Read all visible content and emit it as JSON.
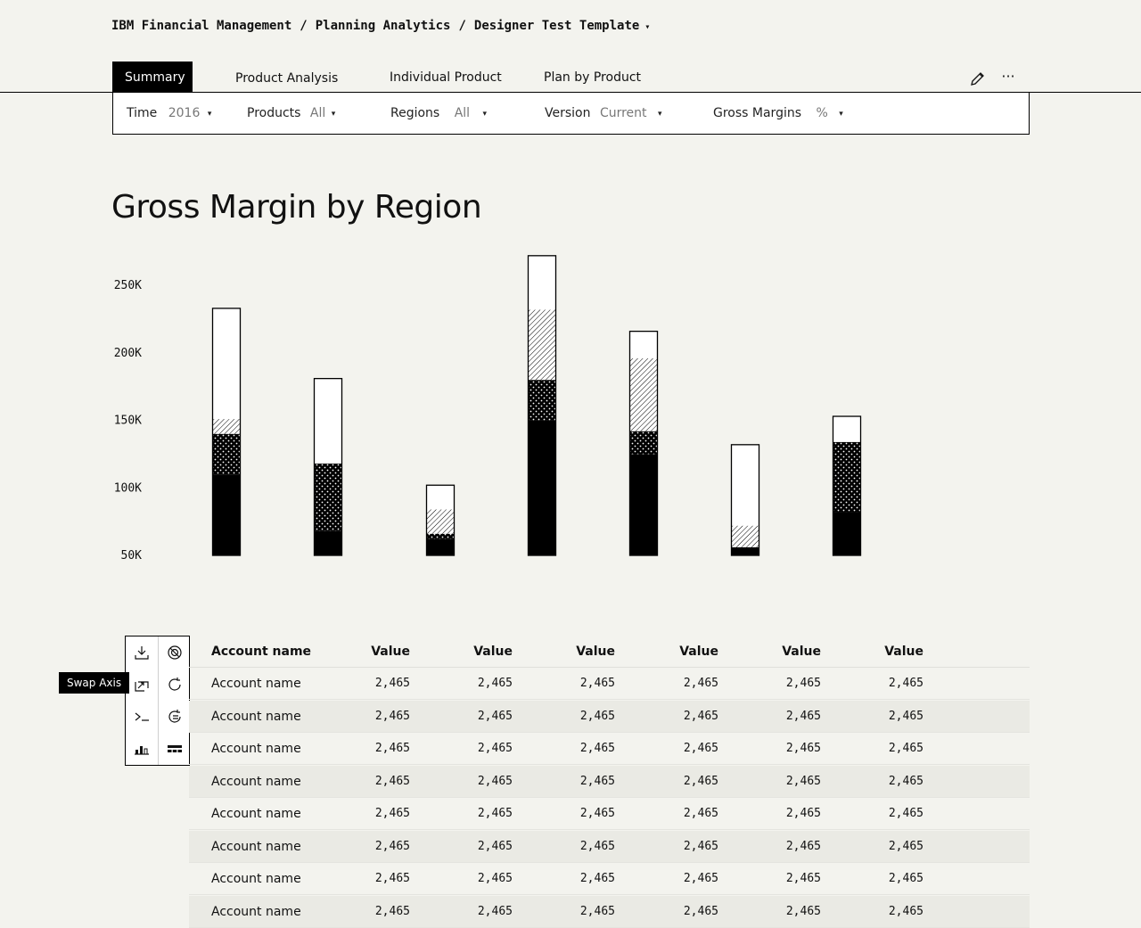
{
  "breadcrumb": {
    "parts": [
      "IBM Financial Management",
      "Planning Analytics",
      "Designer Test Template"
    ],
    "separator": "/",
    "caret": "▾"
  },
  "tabs": [
    {
      "label": "Summary",
      "active": true
    },
    {
      "label": "Product Analysis",
      "active": false
    },
    {
      "label": "Individual Product",
      "active": false
    },
    {
      "label": "Plan by Product",
      "active": false
    }
  ],
  "toolbar_icons": {
    "edit": "pencil-icon",
    "more": "overflow-menu-icon",
    "more_glyph": "···"
  },
  "filters": [
    {
      "label": "Time",
      "value": "2016"
    },
    {
      "label": "Products",
      "value": "All"
    },
    {
      "label": "Regions",
      "value": "All"
    },
    {
      "label": "Version",
      "value": "Current"
    },
    {
      "label": "Gross Margins",
      "value": "%"
    }
  ],
  "filter_caret": "▾",
  "page_title": "Gross Margin by Region",
  "chart_data": {
    "type": "bar",
    "stacked": true,
    "title": "Gross Margin by Region",
    "xlabel": "",
    "ylabel": "",
    "y_ticks": [
      {
        "value": 50000,
        "label": "50K"
      },
      {
        "value": 100000,
        "label": "100K"
      },
      {
        "value": 150000,
        "label": "150K"
      },
      {
        "value": 200000,
        "label": "200K"
      },
      {
        "value": 250000,
        "label": "250K"
      }
    ],
    "ylim": [
      50000,
      260000
    ],
    "categories": [
      "",
      "",
      "",
      "",
      "",
      "",
      ""
    ],
    "series": [
      {
        "pattern": "solid",
        "values": [
          60000,
          18000,
          12000,
          100000,
          75000,
          6000,
          32000
        ]
      },
      {
        "pattern": "dotted",
        "values": [
          30000,
          50000,
          4000,
          30000,
          17000,
          0,
          52000
        ]
      },
      {
        "pattern": "hatched",
        "values": [
          11000,
          0,
          18000,
          52000,
          54000,
          16000,
          0
        ]
      },
      {
        "pattern": "empty",
        "values": [
          82000,
          63000,
          18000,
          40000,
          20000,
          60000,
          19000
        ]
      }
    ],
    "grid": false,
    "legend": "none"
  },
  "tools": [
    {
      "name": "download-icon",
      "label": "Download"
    },
    {
      "name": "disable-icon",
      "label": "Disable"
    },
    {
      "name": "swap-axis-icon",
      "label": "Swap Axis"
    },
    {
      "name": "refresh-icon",
      "label": "Refresh"
    },
    {
      "name": "terminal-icon",
      "label": "Terminal"
    },
    {
      "name": "redo-icon",
      "label": "Redo"
    },
    {
      "name": "chart-view-icon",
      "label": "Chart view"
    },
    {
      "name": "table-view-icon",
      "label": "Table view"
    }
  ],
  "tooltip": "Swap Axis",
  "table": {
    "columns": [
      "Account name",
      "Value",
      "Value",
      "Value",
      "Value",
      "Value",
      "Value"
    ],
    "rows": [
      [
        "Account name",
        "2,465",
        "2,465",
        "2,465",
        "2,465",
        "2,465",
        "2,465"
      ],
      [
        "Account name",
        "2,465",
        "2,465",
        "2,465",
        "2,465",
        "2,465",
        "2,465"
      ],
      [
        "Account name",
        "2,465",
        "2,465",
        "2,465",
        "2,465",
        "2,465",
        "2,465"
      ],
      [
        "Account name",
        "2,465",
        "2,465",
        "2,465",
        "2,465",
        "2,465",
        "2,465"
      ],
      [
        "Account name",
        "2,465",
        "2,465",
        "2,465",
        "2,465",
        "2,465",
        "2,465"
      ],
      [
        "Account name",
        "2,465",
        "2,465",
        "2,465",
        "2,465",
        "2,465",
        "2,465"
      ],
      [
        "Account name",
        "2,465",
        "2,465",
        "2,465",
        "2,465",
        "2,465",
        "2,465"
      ],
      [
        "Account name",
        "2,465",
        "2,465",
        "2,465",
        "2,465",
        "2,465",
        "2,465"
      ]
    ]
  }
}
